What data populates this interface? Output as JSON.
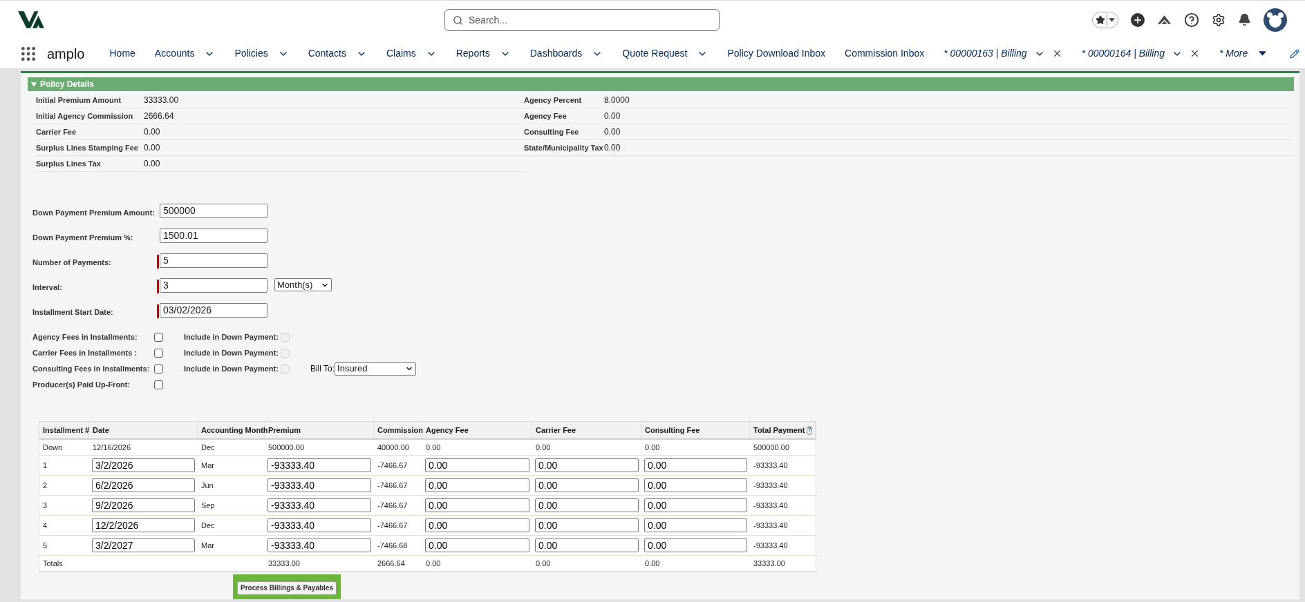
{
  "header": {
    "search": {
      "placeholder": "Search..."
    }
  },
  "nav": {
    "app_name": "amplo",
    "items": [
      {
        "label": "Home",
        "dropdown": false
      },
      {
        "label": "Accounts",
        "dropdown": true
      },
      {
        "label": "Policies",
        "dropdown": true
      },
      {
        "label": "Contacts",
        "dropdown": true
      },
      {
        "label": "Claims",
        "dropdown": true
      },
      {
        "label": "Reports",
        "dropdown": true
      },
      {
        "label": "Dashboards",
        "dropdown": true
      },
      {
        "label": "Quote Request",
        "dropdown": true
      },
      {
        "label": "Policy Download Inbox",
        "dropdown": false
      },
      {
        "label": "Commission Inbox",
        "dropdown": false
      }
    ],
    "tabs": [
      {
        "label": "* 00000163 | Billing"
      },
      {
        "label": "* 00000164 | Billing"
      }
    ],
    "more": "* More"
  },
  "policy_details": {
    "title": "Policy Details",
    "expanded": true,
    "left": [
      {
        "label": "Initial Premium Amount",
        "value": "33333.00"
      },
      {
        "label": "Initial Agency Commission",
        "value": "2666.64"
      },
      {
        "label": "Carrier Fee",
        "value": "0.00"
      },
      {
        "label": "Surplus Lines Stamping Fee",
        "value": "0.00"
      },
      {
        "label": "Surplus Lines Tax",
        "value": "0.00"
      }
    ],
    "right": [
      {
        "label": "Agency Percent",
        "value": "8.0000"
      },
      {
        "label": "Agency Fee",
        "value": "0.00"
      },
      {
        "label": "Consulting Fee",
        "value": "0.00"
      },
      {
        "label": "State/Municipality Tax",
        "value": "0.00"
      }
    ]
  },
  "form": {
    "fields": [
      {
        "label": "Down Payment Premium Amount:",
        "value": "500000",
        "required": false
      },
      {
        "label": "Down Payment Premium %:",
        "value": "1500.01",
        "required": false
      },
      {
        "label": "Number of Payments:",
        "value": "5",
        "required": true
      },
      {
        "label": "Interval:",
        "value": "3",
        "required": true,
        "select": "Month(s)"
      },
      {
        "label": "Installment Start Date:",
        "value": "03/02/2026",
        "required": true
      }
    ],
    "checkboxes": [
      {
        "label": "Agency Fees in Installments:",
        "checked": false,
        "include": {
          "label": "Include in Down Payment:",
          "checked": false,
          "disabled": true
        }
      },
      {
        "label": "Carrier Fees in Installments :",
        "checked": false,
        "include": {
          "label": "Include in Down Payment:",
          "checked": false,
          "disabled": true
        }
      },
      {
        "label": "Consulting Fees in Installments:",
        "checked": false,
        "include": {
          "label": "Include in Down Payment:",
          "checked": false,
          "disabled": true
        },
        "bill_to": {
          "label": "Bill To:",
          "value": "Insured"
        }
      },
      {
        "label": "Producer(s) Paid Up-Front:",
        "checked": false
      }
    ]
  },
  "table": {
    "columns": [
      {
        "label": "Installment #",
        "editable": false
      },
      {
        "label": "Date",
        "editable": true
      },
      {
        "label": "Accounting Month",
        "editable": false
      },
      {
        "label": "Premium",
        "editable": true
      },
      {
        "label": "Commission",
        "editable": false
      },
      {
        "label": "Agency Fee",
        "editable": true
      },
      {
        "label": "Carrier Fee",
        "editable": true
      },
      {
        "label": "Consulting Fee",
        "editable": true
      },
      {
        "label": "Total Payment",
        "editable": false,
        "help": "?"
      }
    ],
    "rows": [
      {
        "kind": "text",
        "cells": [
          "Down",
          "12/16/2026",
          "Dec",
          "500000.00",
          "40000.00",
          "0.00",
          "0.00",
          "0.00",
          "500000.00"
        ]
      },
      {
        "kind": "input",
        "cells": [
          "1",
          "3/2/2026",
          "Mar",
          "-93333.40",
          "-7466.67",
          "0.00",
          "0.00",
          "0.00",
          "-93333.40"
        ]
      },
      {
        "kind": "input",
        "cells": [
          "2",
          "6/2/2026",
          "Jun",
          "-93333.40",
          "-7466.67",
          "0.00",
          "0.00",
          "0.00",
          "-93333.40"
        ]
      },
      {
        "kind": "input",
        "cells": [
          "3",
          "9/2/2026",
          "Sep",
          "-93333.40",
          "-7466.67",
          "0.00",
          "0.00",
          "0.00",
          "-93333.40"
        ]
      },
      {
        "kind": "input",
        "cells": [
          "4",
          "12/2/2026",
          "Dec",
          "-93333.40",
          "-7466.67",
          "0.00",
          "0.00",
          "0.00",
          "-93333.40"
        ]
      },
      {
        "kind": "input",
        "cells": [
          "5",
          "3/2/2027",
          "Mar",
          "-93333.40",
          "-7466.68",
          "0.00",
          "0.00",
          "0.00",
          "-93333.40"
        ]
      },
      {
        "kind": "text",
        "cells": [
          "Totals",
          null,
          null,
          "33333.00",
          "2666.64",
          "0.00",
          "0.00",
          "0.00",
          "33333.00"
        ]
      }
    ]
  },
  "action": {
    "label": "Process Billings & Payables",
    "highlighted": true
  }
}
